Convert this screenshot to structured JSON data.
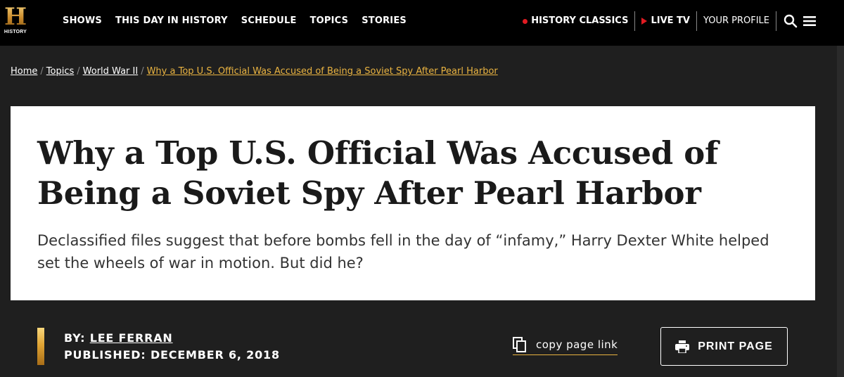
{
  "header": {
    "logo_letter": "H",
    "logo_word": "HISTORY",
    "nav": [
      "SHOWS",
      "THIS DAY IN HISTORY",
      "SCHEDULE",
      "TOPICS",
      "STORIES"
    ],
    "history_classics": "HISTORY CLASSICS",
    "live_tv": "LIVE TV",
    "your_profile": "YOUR PROFILE",
    "accent_red": "#e11b22"
  },
  "breadcrumb": {
    "items": [
      "Home",
      "Topics",
      "World War II"
    ],
    "current": "Why a Top U.S. Official Was Accused of Being a Soviet Spy After Pearl Harbor",
    "separator": "/"
  },
  "article": {
    "title": "Why a Top U.S. Official Was Accused of Being a Soviet Spy After Pearl Harbor",
    "dek": "Declassified files suggest that before bombs fell in the day of “infamy,” Harry Dexter White helped set the wheels of war in motion. But did he?",
    "by_prefix": "BY:",
    "author": "LEE FERRAN",
    "published_prefix": "PUBLISHED:",
    "published_date": "DECEMBER 6, 2018"
  },
  "actions": {
    "copy_link": "copy page link",
    "print": "PRINT PAGE"
  },
  "colors": {
    "gold": "#e9b341",
    "background": "#1f1f1f",
    "header_bg": "#000000"
  }
}
